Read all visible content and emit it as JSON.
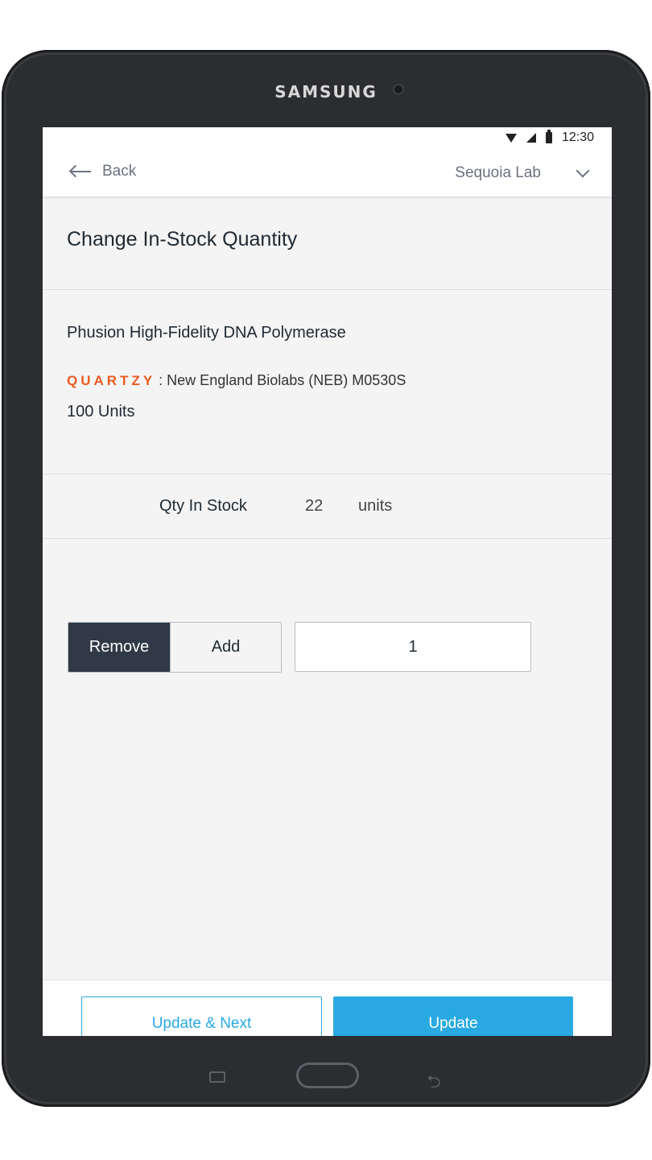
{
  "device": {
    "brand": "SAMSUNG"
  },
  "status_bar": {
    "time": "12:30"
  },
  "header": {
    "back_label": "Back",
    "lab_name": "Sequoia Lab"
  },
  "page": {
    "title": "Change In-Stock Quantity"
  },
  "product": {
    "name": "Phusion High-Fidelity DNA Polymerase",
    "logo_text": "QUARTZY",
    "supplier": ": New England Biolabs (NEB) M0530S",
    "size": "100 Units"
  },
  "stock": {
    "label": "Qty In Stock",
    "value": "22",
    "unit": "units"
  },
  "adjust": {
    "remove_label": "Remove",
    "add_label": "Add",
    "selected": "Remove",
    "quantity": "1"
  },
  "footer": {
    "update_next_label": "Update & Next",
    "update_label": "Update"
  },
  "colors": {
    "accent": "#29a9e1",
    "selected_toggle": "#2f3a46",
    "brand_logo": "#ea5a21"
  }
}
